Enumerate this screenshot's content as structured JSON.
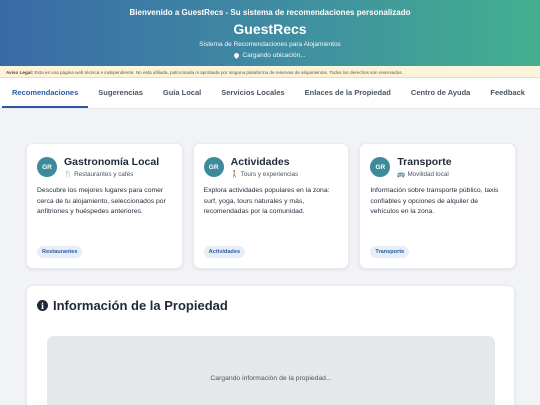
{
  "header": {
    "welcome": "Bienvenido a GuestRecs - Su sistema de recomendaciones personalizado",
    "brand": "GuestRecs",
    "tagline": "Sistema de Recomendaciones para Alojamientos",
    "location": "Cargando ubicación..."
  },
  "legal": {
    "label": "Aviso Legal:",
    "text": "Esta es una página web técnica e independiente. No está afiliada, patrocinada ni aprobada por ninguna plataforma de reservas de alojamientos. Todos los derechos son reservados."
  },
  "tabs": [
    {
      "label": "Recomendaciones",
      "active": true
    },
    {
      "label": "Sugerencias"
    },
    {
      "label": "Guía Local"
    },
    {
      "label": "Servicios Locales"
    },
    {
      "label": "Enlaces de la Propiedad"
    },
    {
      "label": "Centro de Ayuda"
    },
    {
      "label": "Feedback"
    }
  ],
  "cards": [
    {
      "badge": "GR",
      "title": "Gastronomía Local",
      "subtitle": "Restaurantes y cafés",
      "icon": "utensils-icon",
      "description": "Descubre los mejores lugares para comer cerca de tu alojamiento, seleccionados por anfitriones y huéspedes anteriores.",
      "tag": "Restaurantes"
    },
    {
      "badge": "GR",
      "title": "Actividades",
      "subtitle": "Tours y experiencias",
      "icon": "person-walking-icon",
      "description": "Explora actividades populares en la zona: surf, yoga, tours naturales y más, recomendadas por la comunidad.",
      "tag": "Actividades"
    },
    {
      "badge": "GR",
      "title": "Transporte",
      "subtitle": "Movilidad local",
      "icon": "bus-icon",
      "description": "Información sobre transporte público, taxis confiables y opciones de alquiler de vehículos en la zona.",
      "tag": "Transporte"
    }
  ],
  "info": {
    "title": "Información de la Propiedad",
    "loading": "Cargando información de la propiedad..."
  },
  "colors": {
    "accent": "#2c5aa0",
    "badge": "#3d8b9a",
    "legal_bg": "#fdf4dc"
  }
}
